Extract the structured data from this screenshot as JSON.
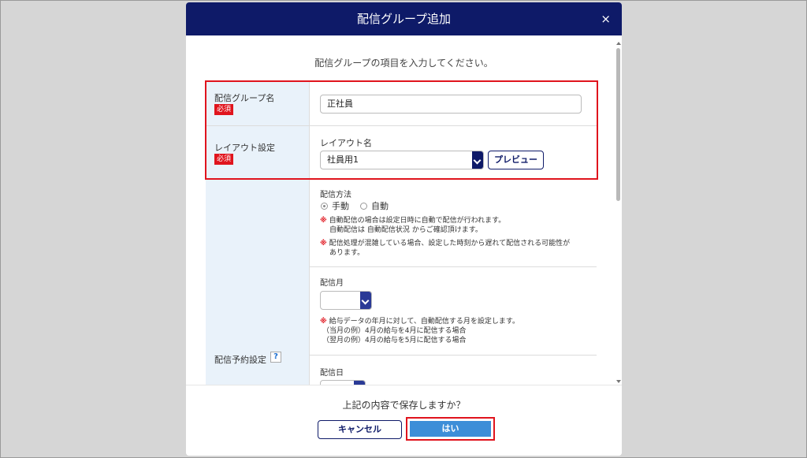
{
  "dialog": {
    "title": "配信グループ追加",
    "close_icon": "×"
  },
  "instruction": "配信グループの項目を入力してください。",
  "form": {
    "group_name": {
      "label": "配信グループ名",
      "required": "必須",
      "value": "正社員"
    },
    "layout": {
      "label": "レイアウト設定",
      "required": "必須",
      "sub_label": "レイアウト名",
      "selected": "社員用1",
      "preview_button": "プレビュー"
    },
    "schedule": {
      "label": "配信予約設定",
      "help_icon": "?",
      "method_label": "配信方法",
      "options": [
        "手動",
        "自動"
      ],
      "selected_option": "手動",
      "notes": [
        {
          "mark": "※",
          "lines": [
            "自動配信の場合は設定日時に自動で配信が行われます。",
            "自動配信は 自動配信状況 からご確認頂けます。"
          ]
        },
        {
          "mark": "※",
          "lines": [
            "配信処理が混雑している場合、設定した時刻から遅れて配信される可能性が",
            "あります。"
          ]
        }
      ],
      "month_label": "配信月",
      "month_value": "",
      "month_notes": {
        "mark": "※",
        "lines": [
          "給与データの年月に対して、自動配信する月を設定します。",
          "（当月の例）4月の給与を4月に配信する場合",
          "（翌月の例）4月の給与を5月に配信する場合"
        ]
      },
      "day_label": "配信日"
    }
  },
  "footer": {
    "confirm": "上記の内容で保存しますか？",
    "cancel_button": "キャンセル",
    "yes_button": "はい"
  },
  "colors": {
    "header": "#0e1a68",
    "required": "#e0141d",
    "highlight": "#e0141d",
    "primary_button": "#3d8ed8",
    "label_bg": "#e9f2fa"
  }
}
